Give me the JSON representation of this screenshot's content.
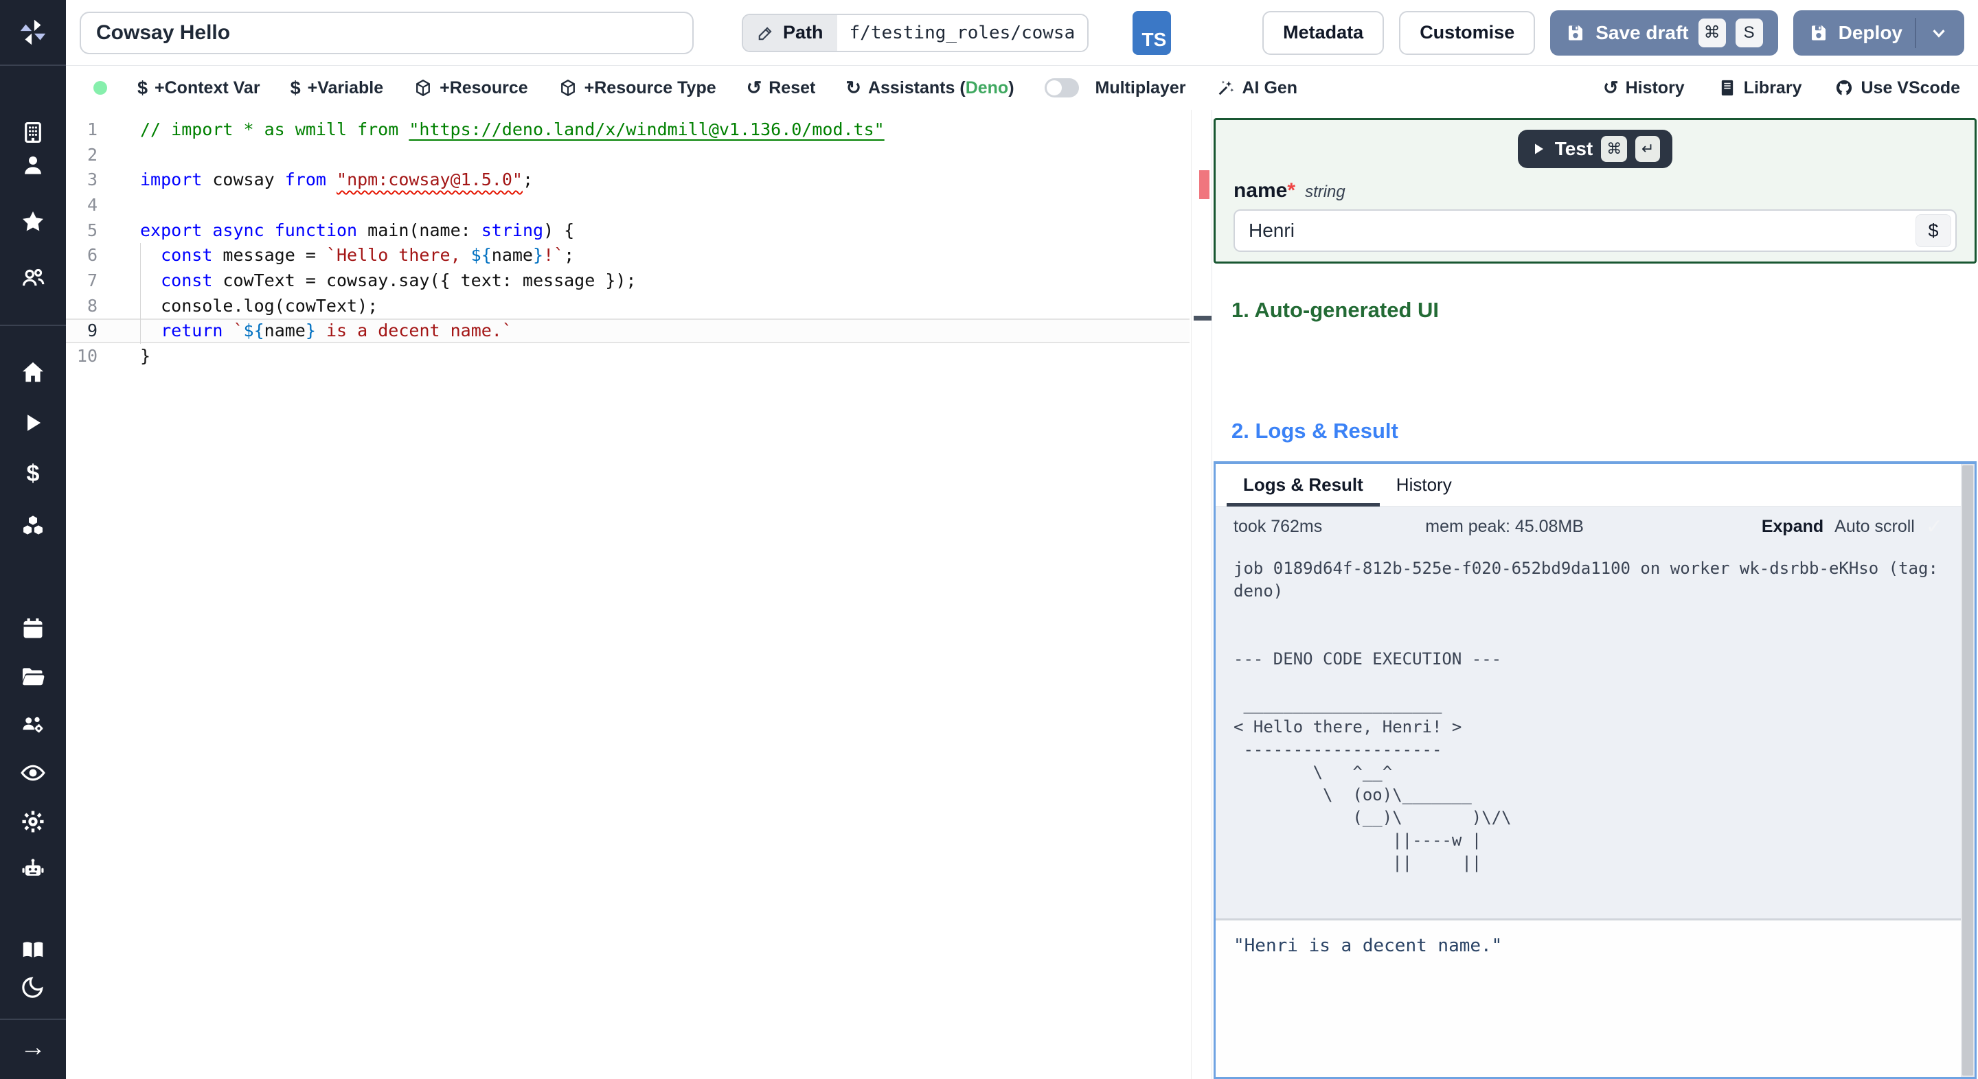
{
  "header": {
    "title": "Cowsay Hello",
    "path_label": "Path",
    "path_value": "f/testing_roles/cowsa",
    "ts_badge": "TS",
    "metadata": "Metadata",
    "customise": "Customise",
    "save_draft": "Save draft",
    "shortcut_mod": "⌘",
    "shortcut_key": "S",
    "deploy": "Deploy"
  },
  "toolbar": {
    "context_var": "+Context Var",
    "variable": "+Variable",
    "resource": "+Resource",
    "resource_type": "+Resource Type",
    "reset": "Reset",
    "assistants_prefix": "Assistants (",
    "assistants_lang": "Deno",
    "assistants_suffix": ")",
    "multiplayer": "Multiplayer",
    "ai_gen": "AI Gen",
    "history": "History",
    "library": "Library",
    "use_vscode": "Use VScode"
  },
  "glyphs": {
    "dollar": "$",
    "reset": "↺",
    "assistants": "↻",
    "history": "↺",
    "check": "✓",
    "arrow_right": "→"
  },
  "editor": {
    "active_line": 9,
    "lines": [
      {
        "n": "1",
        "tokens": [
          [
            "cm",
            "// import * as wmill from "
          ],
          [
            "cm lnk",
            "\"https://deno.land/x/windmill@v1.136.0/mod.ts\""
          ]
        ]
      },
      {
        "n": "2",
        "tokens": []
      },
      {
        "n": "3",
        "tokens": [
          [
            "kw",
            "import"
          ],
          [
            "pl",
            " cowsay "
          ],
          [
            "kw",
            "from"
          ],
          [
            "pl",
            " "
          ],
          [
            "str sq",
            "\"npm:cowsay@1.5.0\""
          ],
          [
            "pl",
            ";"
          ]
        ]
      },
      {
        "n": "4",
        "tokens": []
      },
      {
        "n": "5",
        "tokens": [
          [
            "kw",
            "export"
          ],
          [
            "pl",
            " "
          ],
          [
            "kw",
            "async"
          ],
          [
            "pl",
            " "
          ],
          [
            "kw",
            "function"
          ],
          [
            "pl",
            " main(name: "
          ],
          [
            "kw",
            "string"
          ],
          [
            "pl",
            ") {"
          ]
        ]
      },
      {
        "n": "6",
        "tokens": [
          [
            "pl",
            "  "
          ],
          [
            "kw",
            "const"
          ],
          [
            "pl",
            " message = "
          ],
          [
            "str",
            "`Hello there, "
          ],
          [
            "dl",
            "${"
          ],
          [
            "pl",
            "name"
          ],
          [
            "dl",
            "}"
          ],
          [
            "str",
            "!`"
          ],
          [
            "pl",
            ";"
          ]
        ]
      },
      {
        "n": "7",
        "tokens": [
          [
            "pl",
            "  "
          ],
          [
            "kw",
            "const"
          ],
          [
            "pl",
            " cowText = cowsay.say({ text: message });"
          ]
        ]
      },
      {
        "n": "8",
        "tokens": [
          [
            "pl",
            "  console.log(cowText);"
          ]
        ]
      },
      {
        "n": "9",
        "tokens": [
          [
            "pl",
            "  "
          ],
          [
            "kw",
            "return"
          ],
          [
            "pl",
            " "
          ],
          [
            "str",
            "`"
          ],
          [
            "dl",
            "${"
          ],
          [
            "pl",
            "name"
          ],
          [
            "dl",
            "}"
          ],
          [
            "str",
            " is a decent name.`"
          ]
        ]
      },
      {
        "n": "10",
        "tokens": [
          [
            "pl",
            "}"
          ]
        ]
      }
    ]
  },
  "form": {
    "test": "Test",
    "test_mod": "⌘",
    "test_enter": "↵",
    "field_label": "name",
    "required": "*",
    "field_type": "string",
    "field_value": "Henri",
    "var_picker": "$"
  },
  "sections": {
    "auto_ui": "1. Auto-generated UI",
    "logs_result": "2. Logs & Result"
  },
  "logs": {
    "tab_logs": "Logs & Result",
    "tab_history": "History",
    "took": "took 762ms",
    "mem_peak": "mem peak: 45.08MB",
    "expand": "Expand",
    "auto_scroll": "Auto scroll",
    "log_lines": [
      "job 0189d64f-812b-525e-f020-652bd9da1100 on worker wk-dsrbb-eKHso (tag:",
      "deno)",
      "",
      "",
      "--- DENO CODE EXECUTION ---",
      "",
      " ____________________",
      "< Hello there, Henri! >",
      " --------------------",
      "        \\   ^__^",
      "         \\  (oo)\\_______",
      "            (__)\\       )\\/\\",
      "                ||----w |",
      "                ||     ||"
    ],
    "result": "\"Henri is a decent name.\""
  },
  "colors": {
    "sidebar_bg": "#1d2330",
    "slate_button": "#6b81a6",
    "ts_blue": "#3b78c6",
    "green_heading": "#236b35",
    "blue_heading": "#3b82f6",
    "deno_green": "#3fa860",
    "logs_border": "#6fa3e2",
    "error_red": "#f0767e",
    "status_dot_green": "#86efac",
    "form_border_green": "#195732"
  }
}
